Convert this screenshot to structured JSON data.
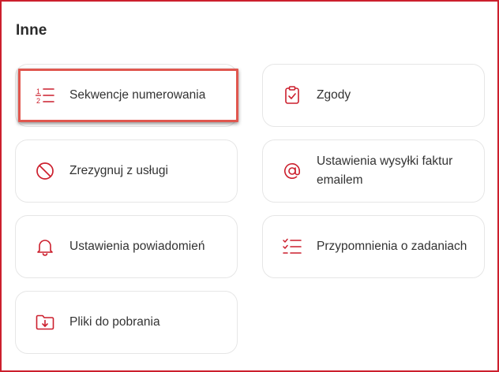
{
  "section": {
    "title": "Inne"
  },
  "colors": {
    "accent": "#cc1f2d",
    "highlight": "#e0574f"
  },
  "cards": [
    {
      "label": "Sekwencje numerowania",
      "icon": "numbered-list-icon",
      "highlighted": true
    },
    {
      "label": "Zgody",
      "icon": "clipboard-check-icon"
    },
    {
      "label": "Zrezygnuj z usługi",
      "icon": "prohibited-icon"
    },
    {
      "label": "Ustawienia wysyłki faktur emailem",
      "icon": "at-sign-icon"
    },
    {
      "label": "Ustawienia powiadomień",
      "icon": "bell-icon"
    },
    {
      "label": "Przypomnienia o zadaniach",
      "icon": "checklist-icon"
    },
    {
      "label": "Pliki do pobrania",
      "icon": "folder-download-icon"
    }
  ]
}
